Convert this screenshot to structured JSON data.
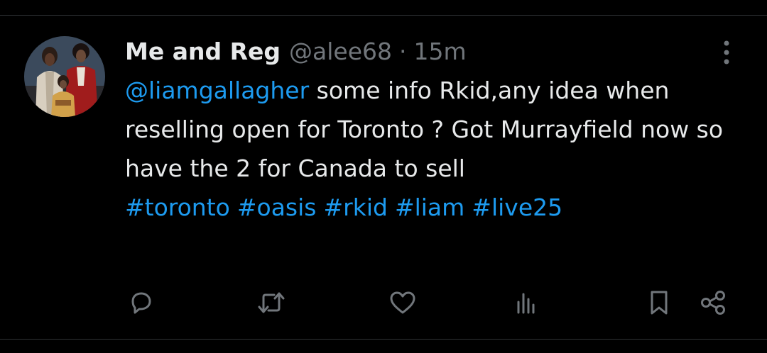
{
  "tweet": {
    "display_name": "Me and Reg",
    "handle": "@alee68",
    "separator": "·",
    "time": "15m",
    "mention": "@liamgallagher",
    "text": " some info Rkid,any idea when reselling open for Toronto ? Got Murrayfield now so have the 2 for Canada to sell",
    "hashtags": [
      "#toronto",
      "#oasis",
      "#rkid",
      "#liam",
      "#live25"
    ]
  },
  "icons": {
    "more": "more-vertical-icon",
    "reply": "reply-icon",
    "repost": "repost-icon",
    "like": "heart-icon",
    "views": "analytics-icon",
    "bookmark": "bookmark-icon",
    "share": "share-icon"
  },
  "colors": {
    "background": "#000000",
    "text": "#e7e9ea",
    "muted": "#71767b",
    "accent": "#1d9bf0",
    "divider": "#2f3336"
  }
}
